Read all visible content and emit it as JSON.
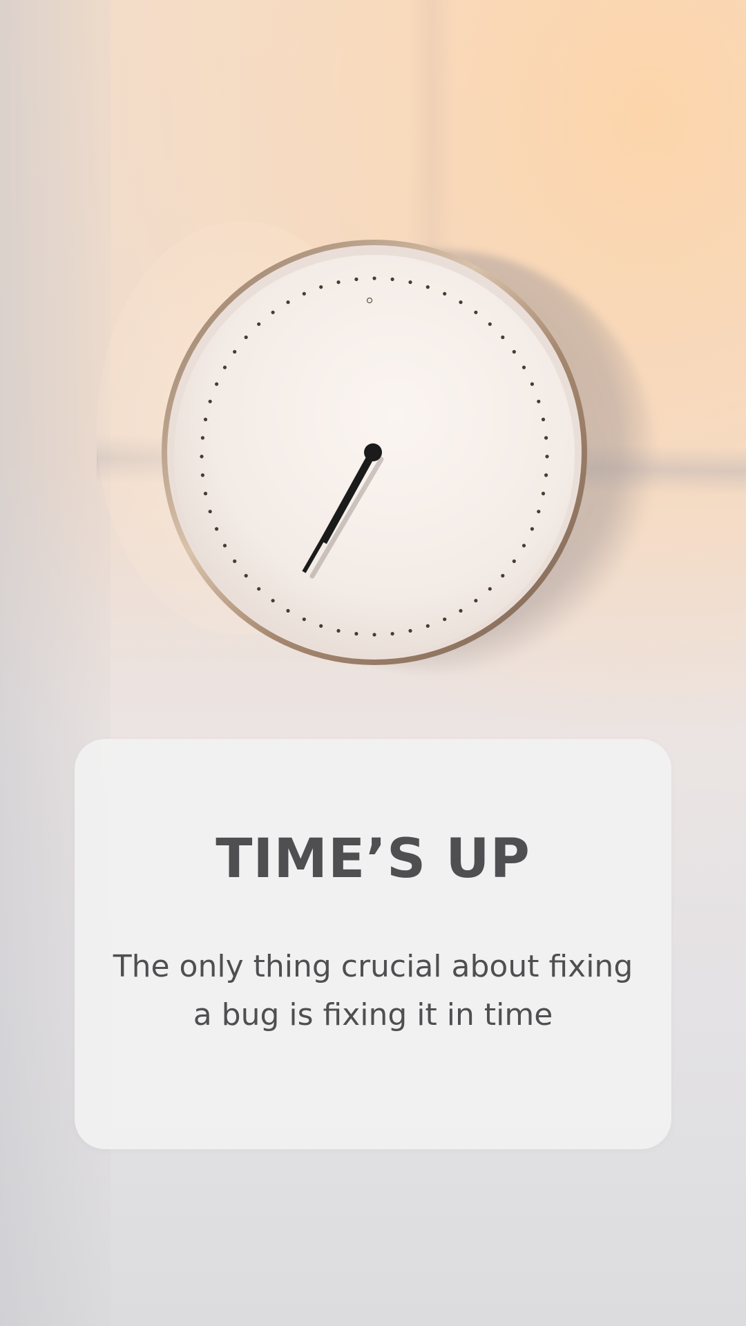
{
  "card": {
    "title": "TIME’S UP",
    "message": "The only thing crucial about fixing a bug is fixing it in time"
  },
  "clock": {
    "minute_hand_minute": 35,
    "hour_hand_hidden_behind_minute": true
  },
  "colors": {
    "text": "#4f4f51",
    "card_background": "#f2f2f3",
    "clock_rim": "#b79a80",
    "clock_face": "#f5eeea",
    "hand": "#1b1b1b"
  }
}
